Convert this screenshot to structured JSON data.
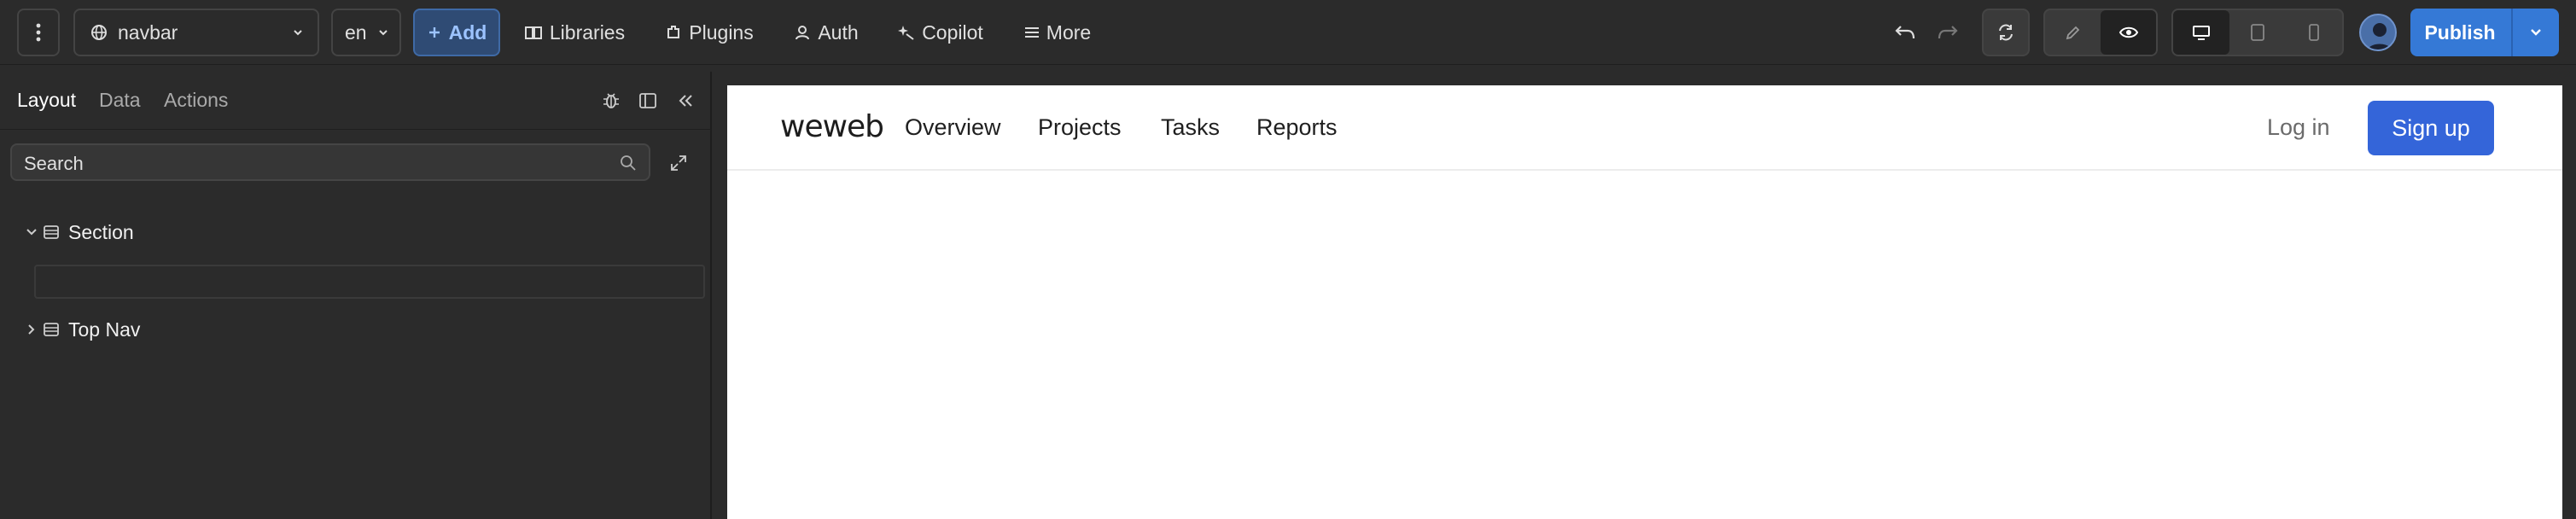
{
  "topbar": {
    "page_selector": {
      "label": "navbar",
      "icon": "globe-icon"
    },
    "lang_selector": {
      "label": "en"
    },
    "add_button": "Add",
    "menu": [
      {
        "label": "Libraries",
        "icon": "book-icon"
      },
      {
        "label": "Plugins",
        "icon": "plugin-icon"
      },
      {
        "label": "Auth",
        "icon": "user-icon"
      },
      {
        "label": "Copilot",
        "icon": "sparkle-icon"
      },
      {
        "label": "More",
        "icon": "menu-icon"
      }
    ],
    "publish_label": "Publish"
  },
  "left_panel": {
    "tabs": [
      {
        "label": "Layout",
        "active": true
      },
      {
        "label": "Data",
        "active": false
      },
      {
        "label": "Actions",
        "active": false
      }
    ],
    "search": {
      "placeholder": "Search",
      "value": ""
    },
    "tree": [
      {
        "label": "Section",
        "expanded": true
      },
      {
        "label": "Top Nav",
        "expanded": false
      }
    ]
  },
  "preview": {
    "logo": "weweb",
    "nav_links": [
      "Overview",
      "Projects",
      "Tasks",
      "Reports"
    ],
    "login_label": "Log in",
    "signup_label": "Sign up"
  },
  "colors": {
    "accent": "#3579d6",
    "add_bg": "#2f4b74",
    "signup_bg": "#3465d9",
    "panel_bg": "#2b2b2b"
  }
}
